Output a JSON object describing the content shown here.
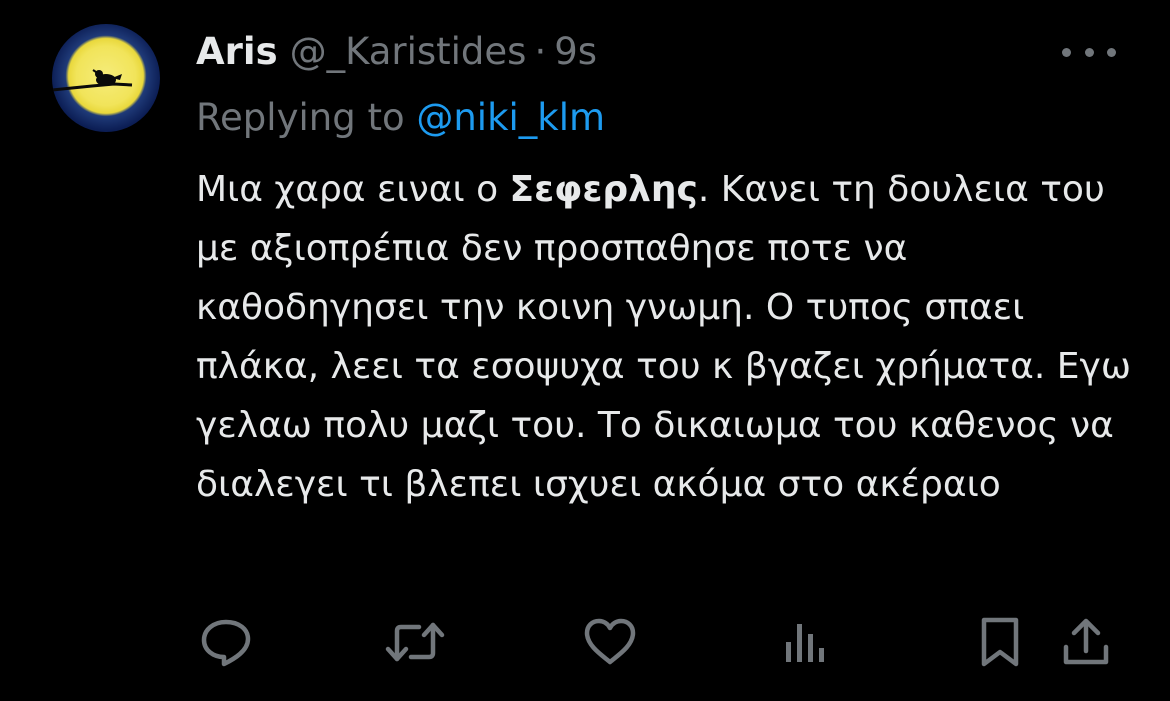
{
  "tweet": {
    "display_name": "Aris",
    "handle": "@_Karistides",
    "separator": "·",
    "time": "9s",
    "replying_prefix": "Replying to ",
    "replying_mention": "@niki_klm",
    "body_before_bold": "Μια χαρα ειναι ο ",
    "body_bold": "Σεφερλης",
    "body_after_bold": ". Κανει τη δουλεια του με αξιοπρέπια δεν προσπαθησε ποτε να καθοδηγησει την κοινη γνωμη. Ο τυπος σπαει πλάκα, λεει τα εσοψυχα του κ βγαζει χρήματα. Εγω γελαω πολυ μαζι του. Το δικαιωμα του καθενος να διαλεγει τι βλεπει ισχυει ακόμα στο ακέραιο"
  },
  "actions": [
    {
      "icon": "reply-icon"
    },
    {
      "icon": "retweet-icon"
    },
    {
      "icon": "like-icon"
    },
    {
      "icon": "views-icon"
    },
    {
      "icon": "bookmark-icon"
    },
    {
      "icon": "share-icon"
    }
  ],
  "colors": {
    "background": "#000000",
    "text": "#e7e9ea",
    "secondary": "#71767b",
    "mention": "#1d9bf0"
  }
}
